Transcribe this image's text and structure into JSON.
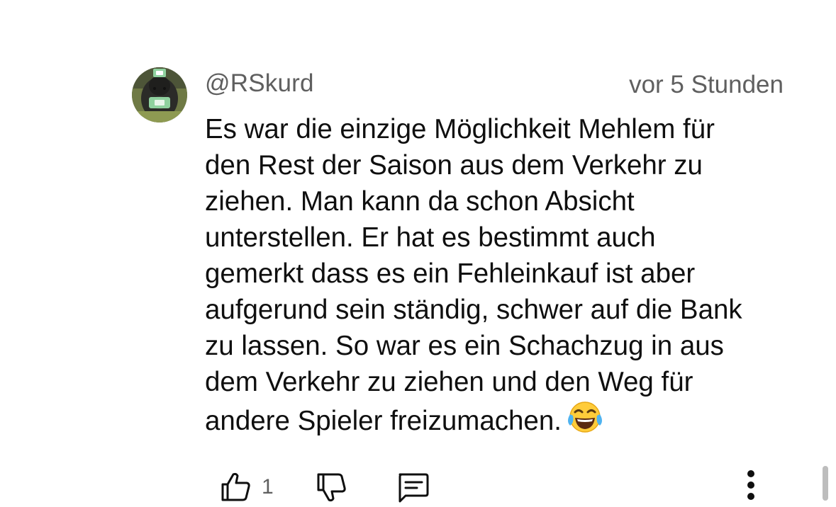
{
  "comment": {
    "author": "@RSkurd",
    "timestamp": "vor 5 Stunden",
    "body_lines": [
      "Es war die einzige Möglichkeit Mehlem für",
      "den Rest der Saison aus dem Verkehr zu",
      "ziehen. Man kann da schon Absicht",
      "unterstellen. Er hat es bestimmt auch",
      "gemerkt dass es ein Fehleinkauf ist aber",
      "aufgerund sein ständig, schwer auf die Bank",
      "zu lassen. So war es ein Schachzug in aus",
      "dem Verkehr zu ziehen und den Weg für",
      "andere Spieler freizumachen."
    ],
    "emoji": "face-with-tears-of-joy",
    "like_count": "1"
  },
  "icons": {
    "like": "thumbs-up-icon",
    "dislike": "thumbs-down-icon",
    "reply": "comment-icon",
    "more": "more-vertical-icon"
  },
  "colors": {
    "text": "#0f0f0f",
    "meta": "#5f5f5f",
    "icon": "#0f0f0f"
  }
}
